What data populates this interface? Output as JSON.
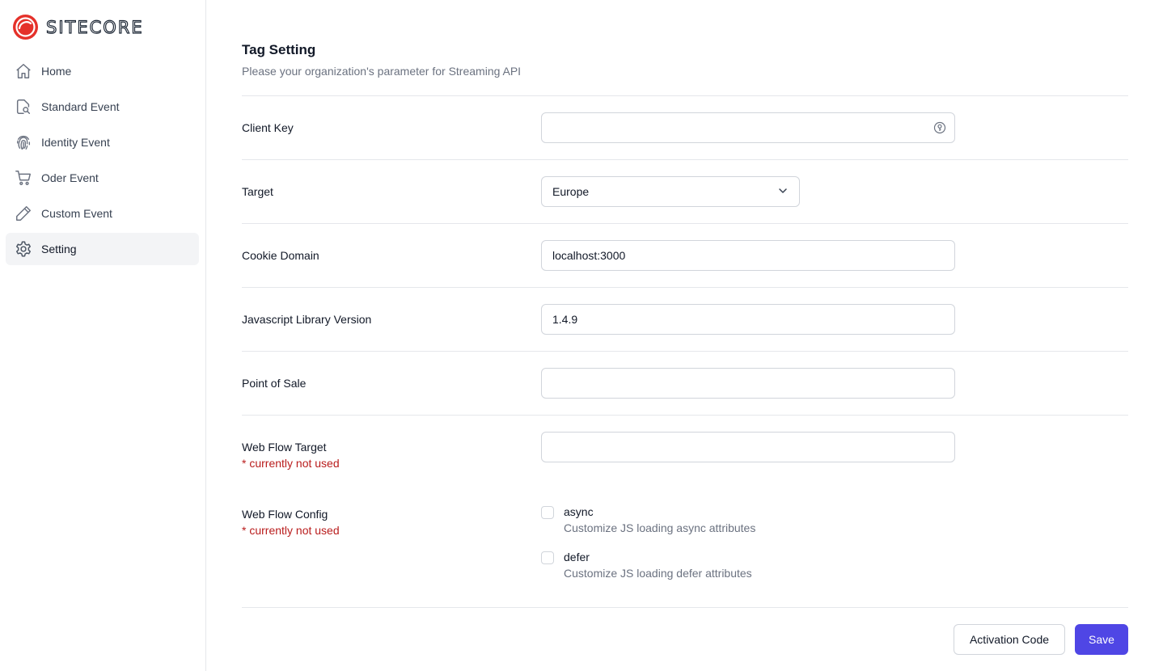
{
  "brand": {
    "name": "SITECORE",
    "logo_color": "#e5312a"
  },
  "sidebar": {
    "items": [
      {
        "label": "Home",
        "icon": "home-icon",
        "active": false
      },
      {
        "label": "Standard Event",
        "icon": "document-search-icon",
        "active": false
      },
      {
        "label": "Identity Event",
        "icon": "fingerprint-icon",
        "active": false
      },
      {
        "label": "Oder Event",
        "icon": "cart-icon",
        "active": false
      },
      {
        "label": "Custom Event",
        "icon": "pencil-icon",
        "active": false
      },
      {
        "label": "Setting",
        "icon": "gear-icon",
        "active": true
      }
    ]
  },
  "page": {
    "title": "Tag Setting",
    "subtitle": "Please your organization's parameter for Streaming API"
  },
  "form": {
    "client_key": {
      "label": "Client Key",
      "value": ""
    },
    "target": {
      "label": "Target",
      "value": "Europe"
    },
    "cookie_domain": {
      "label": "Cookie Domain",
      "value": "localhost:3000"
    },
    "js_version": {
      "label": "Javascript Library Version",
      "value": "1.4.9"
    },
    "point_of_sale": {
      "label": "Point of Sale",
      "value": ""
    },
    "web_flow_target": {
      "label": "Web Flow Target",
      "note": "* currently not used",
      "value": ""
    },
    "web_flow_config": {
      "label": "Web Flow Config",
      "note": "* currently not used",
      "options": [
        {
          "title": "async",
          "description": "Customize JS loading async attributes",
          "checked": false
        },
        {
          "title": "defer",
          "description": "Customize JS loading defer attributes",
          "checked": false
        }
      ]
    }
  },
  "actions": {
    "activation_label": "Activation Code",
    "save_label": "Save"
  },
  "colors": {
    "primary": "#4f46e5",
    "note_red": "#b91c1c",
    "active_bg": "#f3f4f6"
  }
}
